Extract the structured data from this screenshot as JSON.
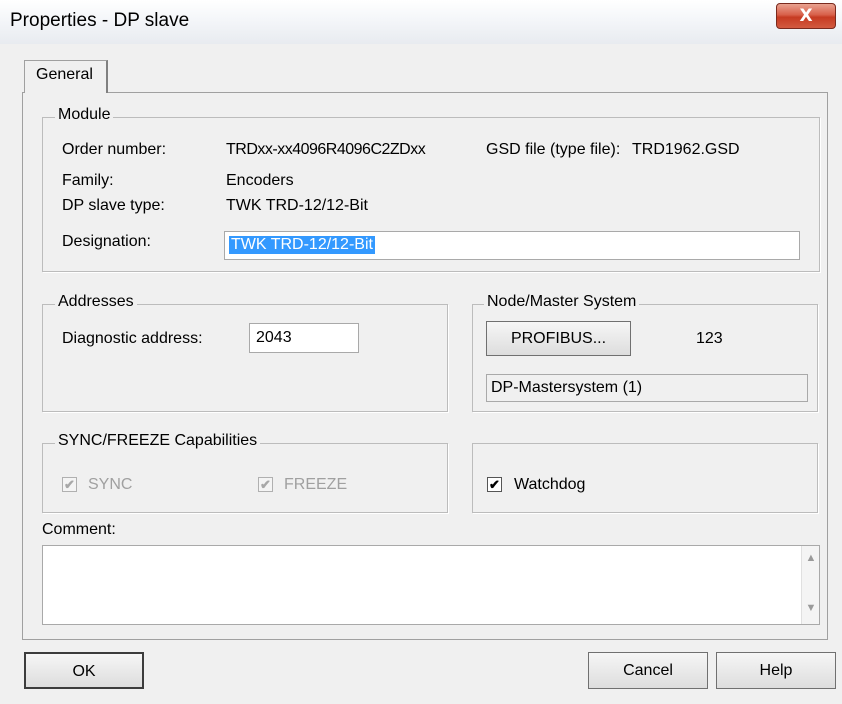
{
  "window": {
    "title": "Properties - DP slave",
    "close_glyph": "X"
  },
  "tabs": [
    {
      "label": "General"
    }
  ],
  "module": {
    "legend": "Module",
    "order_number_label": "Order number:",
    "order_number_value": "TRDxx-xx4096R4096C2ZDxx",
    "gsd_file_label": "GSD file (type file):",
    "gsd_file_value": "TRD1962.GSD",
    "family_label": "Family:",
    "family_value": "Encoders",
    "dp_slave_type_label": "DP slave type:",
    "dp_slave_type_value": "TWK TRD-12/12-Bit",
    "designation_label": "Designation:",
    "designation_value": "TWK TRD-12/12-Bit"
  },
  "addresses": {
    "legend": "Addresses",
    "diagnostic_address_label": "Diagnostic address:",
    "diagnostic_address_value": "2043"
  },
  "node_master": {
    "legend": "Node/Master System",
    "profibus_button": "PROFIBUS...",
    "address_value": "123",
    "master_system": "DP-Mastersystem (1)"
  },
  "sync_freeze": {
    "legend": "SYNC/FREEZE Capabilities",
    "sync_label": "SYNC",
    "sync_checked": true,
    "freeze_label": "FREEZE",
    "freeze_checked": true
  },
  "watchdog": {
    "label": "Watchdog",
    "checked": true
  },
  "comment": {
    "label": "Comment:",
    "value": ""
  },
  "buttons": {
    "ok": "OK",
    "cancel": "Cancel",
    "help": "Help"
  },
  "check_glyph": "✔",
  "icons": {
    "scroll_up": "▲",
    "scroll_down": "▼"
  },
  "colors": {
    "selection": "#3399ff",
    "close_button": "#c63b22",
    "dialog_bg": "#f0f0f0"
  }
}
